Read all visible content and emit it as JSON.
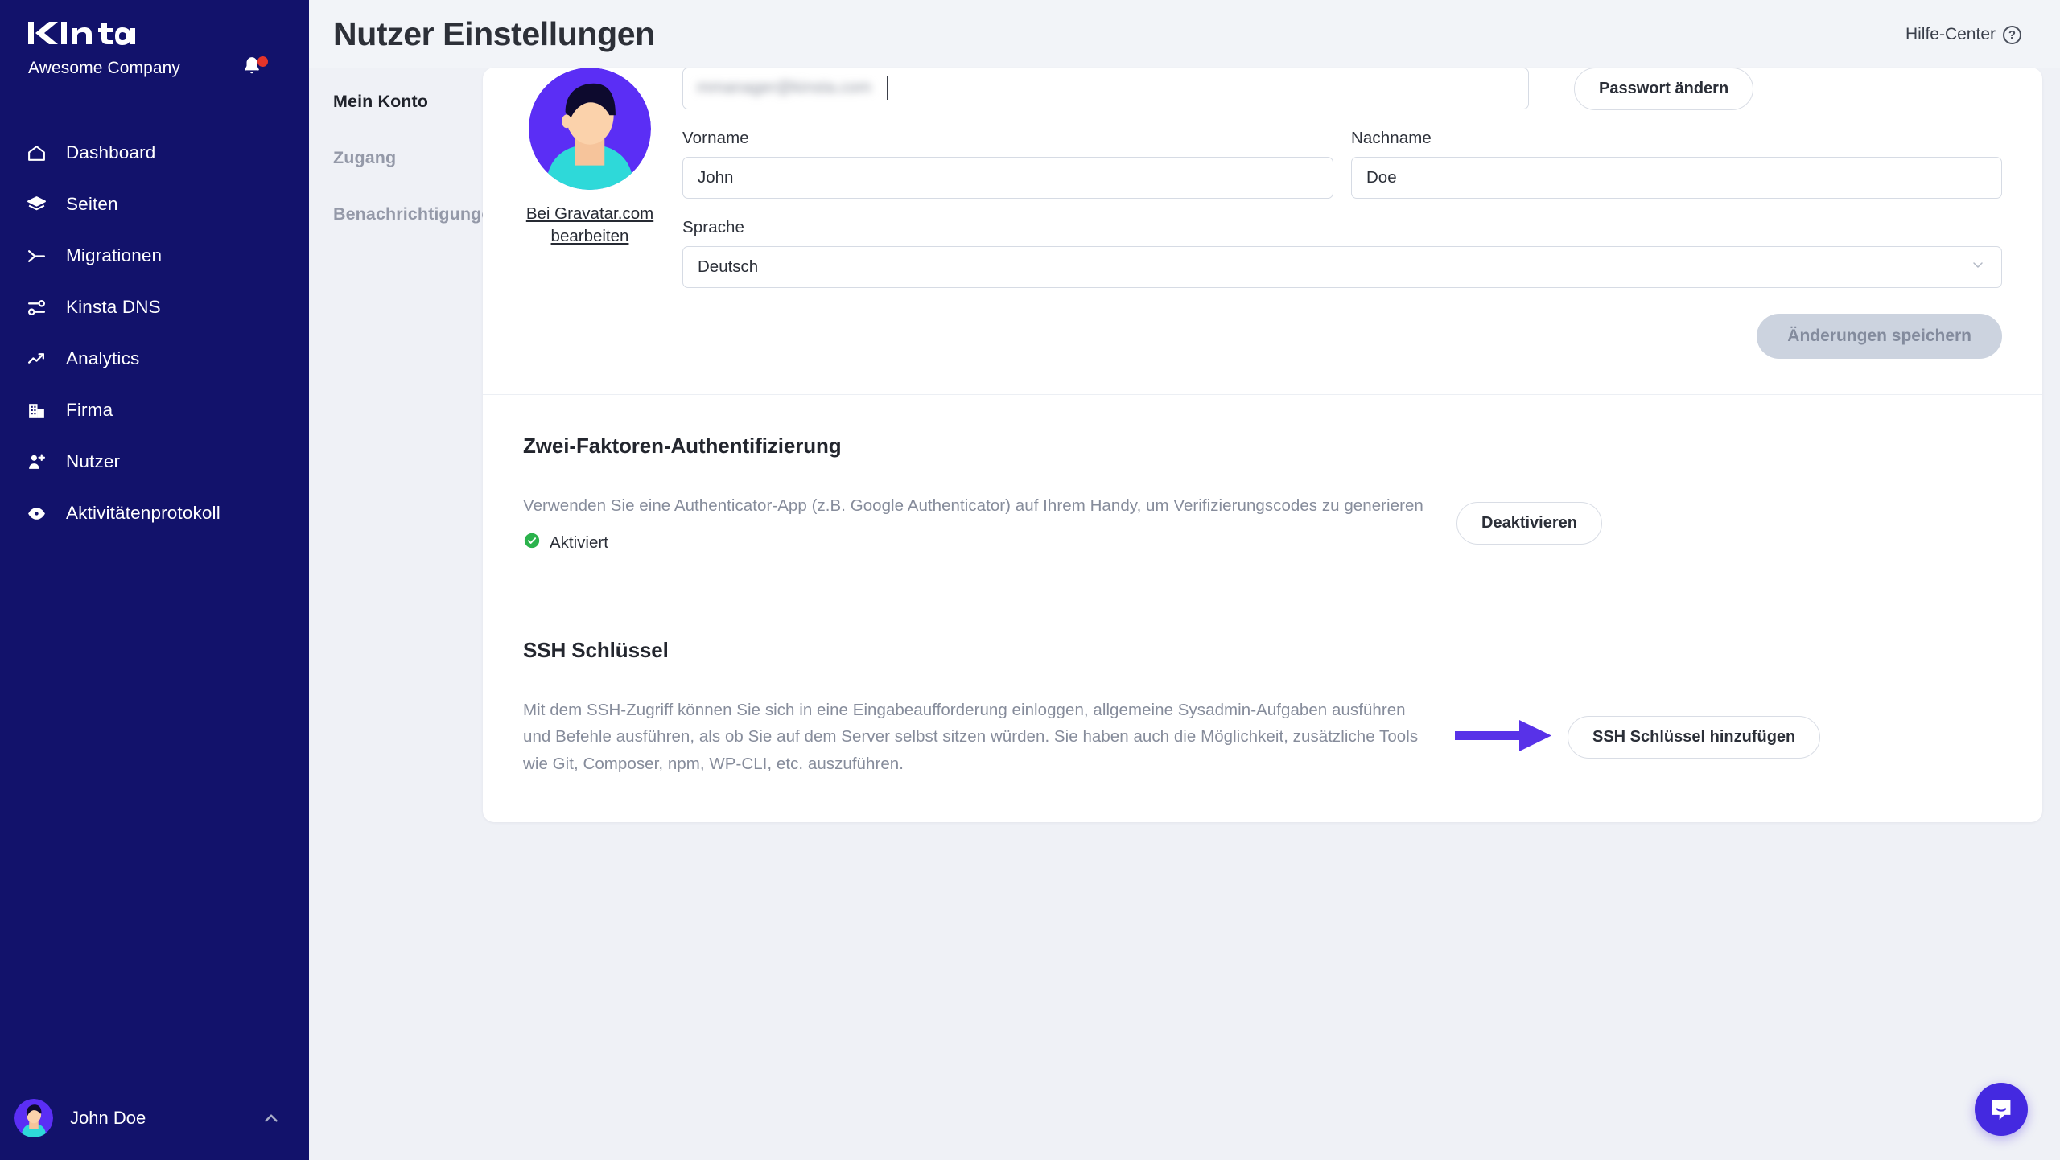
{
  "sidebar": {
    "logo_text": "Kinsta",
    "company": "Awesome Company",
    "notification_icon": "bell-icon",
    "items": [
      {
        "label": "Dashboard",
        "icon": "home-icon"
      },
      {
        "label": "Seiten",
        "icon": "layers-icon"
      },
      {
        "label": "Migrationen",
        "icon": "migration-icon"
      },
      {
        "label": "Kinsta DNS",
        "icon": "dns-nodes-icon"
      },
      {
        "label": "Analytics",
        "icon": "trend-up-icon"
      },
      {
        "label": "Firma",
        "icon": "building-icon"
      },
      {
        "label": "Nutzer",
        "icon": "user-plus-icon"
      },
      {
        "label": "Aktivitätenprotokoll",
        "icon": "eye-icon"
      }
    ],
    "footer": {
      "user_name": "John Doe",
      "chevron_icon": "chevron-up-icon"
    }
  },
  "header": {
    "title": "Nutzer Einstellungen",
    "help_label": "Hilfe-Center",
    "help_icon": "question-circle-icon"
  },
  "subnav": {
    "items": [
      {
        "label": "Mein Konto",
        "active": true
      },
      {
        "label": "Zugang",
        "active": false
      },
      {
        "label": "Benachrichtigungen",
        "active": false
      }
    ]
  },
  "account": {
    "gravatar_link": "Bei Gravatar.com bearbeiten",
    "avatar_icon": "user-avatar-illustration",
    "email": {
      "value": "mmanager@kinsta.com",
      "redacted": true
    },
    "change_password_label": "Passwort ändern",
    "first_name": {
      "label": "Vorname",
      "value": "John"
    },
    "last_name": {
      "label": "Nachname",
      "value": "Doe"
    },
    "language": {
      "label": "Sprache",
      "value": "Deutsch",
      "chevron_icon": "chevron-down-icon"
    },
    "save_label": "Änderungen speichern",
    "save_disabled": true
  },
  "two_factor": {
    "title": "Zwei-Faktoren-Authentifizierung",
    "description": "Verwenden Sie eine Authenticator-App (z.B. Google Authenticator) auf Ihrem Handy, um Verifizierungscodes zu generieren",
    "status_label": "Aktiviert",
    "status_icon": "check-circle-icon",
    "status_color": "#2bb24c",
    "action_label": "Deaktivieren"
  },
  "ssh": {
    "title": "SSH Schlüssel",
    "description": "Mit dem SSH-Zugriff können Sie sich in eine Eingabeaufforderung einloggen, allgemeine Sysadmin-Aufgaben ausführen und Befehle ausführen, als ob Sie auf dem Server selbst sitzen würden. Sie haben auch die Möglichkeit, zusätzliche Tools wie Git, Composer, npm, WP-CLI, etc. auszuführen.",
    "action_label": "SSH Schlüssel hinzufügen",
    "annotation_icon": "purple-arrow-right"
  },
  "chat": {
    "icon": "intercom-chat-icon"
  },
  "colors": {
    "sidebar_bg": "#12126b",
    "accent_purple": "#4f2ff0",
    "page_bg": "#eff1f6",
    "notification_red": "#e5342a",
    "success_green": "#2bb24c",
    "disabled_button": "#ccd3df"
  }
}
